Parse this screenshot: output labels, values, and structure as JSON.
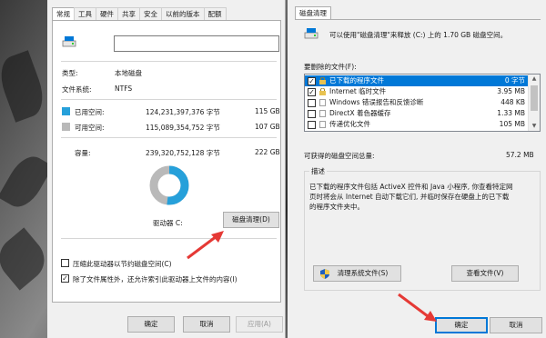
{
  "left": {
    "tabs": [
      "常规",
      "工具",
      "硬件",
      "共享",
      "安全",
      "以前的版本",
      "配额"
    ],
    "active_tab": "常规",
    "name_value": "",
    "type_label": "类型:",
    "type_value": "本地磁盘",
    "fs_label": "文件系统:",
    "fs_value": "NTFS",
    "used_label": "已用空间:",
    "used_bytes": "124,231,397,376 字节",
    "used_gb": "115 GB",
    "free_label": "可用空间:",
    "free_bytes": "115,089,354,752 字节",
    "free_gb": "107 GB",
    "capacity_label": "容量:",
    "capacity_bytes": "239,320,752,128 字节",
    "capacity_gb": "222 GB",
    "drive_label": "驱动器 C:",
    "cleanup_button": "磁盘清理(D)",
    "compress_label": "压缩此驱动器以节约磁盘空间(C)",
    "compress_checked": false,
    "index_label": "除了文件属性外，还允许索引此驱动器上文件的内容(I)",
    "index_checked": true,
    "ok_button": "确定",
    "cancel_button": "取消",
    "apply_button": "应用(A)",
    "used_fraction": 0.519,
    "colors": {
      "used": "#26a0da",
      "free": "#b9b9b9"
    }
  },
  "right": {
    "tab": "磁盘清理",
    "header_text": "可以使用\"磁盘清理\"来释放  (C:) 上的 1.70 GB 磁盘空间。",
    "files_label": "要删除的文件(F):",
    "files": [
      {
        "name": "已下载的程序文件",
        "size": "0 字节",
        "checked": true,
        "selected": true
      },
      {
        "name": "Internet 临时文件",
        "size": "3.95 MB",
        "checked": true,
        "selected": false
      },
      {
        "name": "Windows 错误报告和反馈诊断",
        "size": "448 KB",
        "checked": false,
        "selected": false
      },
      {
        "name": "DirectX 着色器缓存",
        "size": "1.33 MB",
        "checked": false,
        "selected": false
      },
      {
        "name": "传递优化文件",
        "size": "105 MB",
        "checked": false,
        "selected": false
      }
    ],
    "total_label": "可获得的磁盘空间总量:",
    "total_value": "57.2 MB",
    "desc_title": "描述",
    "desc_line1": "已下载的程序文件包括 ActiveX 控件和 Java 小程序, 你查看特定网",
    "desc_line2": "页时将会从 Internet 自动下载它们, 并临时保存在硬盘上的已下载",
    "desc_line3": "的程序文件夹中。",
    "clean_system_button": "清理系统文件(S)",
    "view_files_button": "查看文件(V)",
    "ok_button": "确定",
    "cancel_button": "取消"
  }
}
